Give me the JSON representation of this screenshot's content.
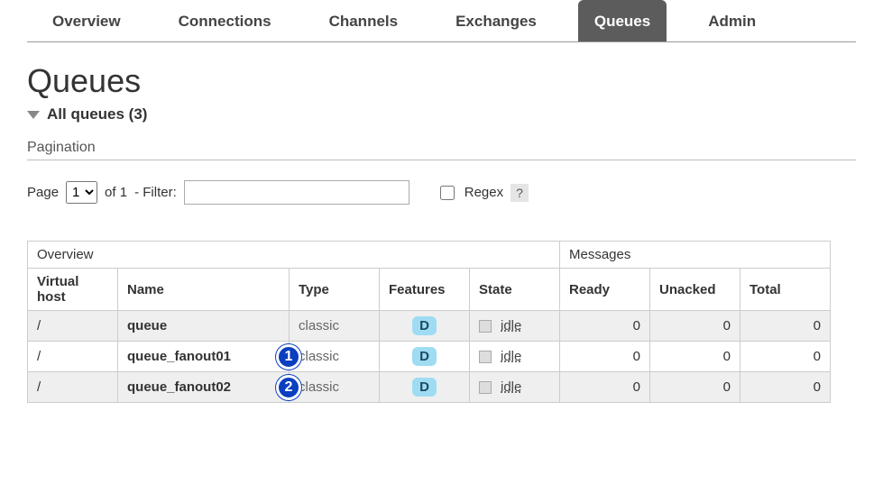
{
  "nav": {
    "overview": "Overview",
    "connections": "Connections",
    "channels": "Channels",
    "exchanges": "Exchanges",
    "queues": "Queues",
    "admin": "Admin"
  },
  "page_title": "Queues",
  "all_queues_label": "All queues (3)",
  "pagination_heading": "Pagination",
  "pag": {
    "page_label": "Page",
    "page_value": "1",
    "of_label": "of 1",
    "filter_label": "- Filter:",
    "filter_value": "",
    "regex_label": "Regex",
    "help": "?"
  },
  "tbl": {
    "group_overview": "Overview",
    "group_messages": "Messages",
    "col_vhost": "Virtual host",
    "col_name": "Name",
    "col_type": "Type",
    "col_features": "Features",
    "col_state": "State",
    "col_ready": "Ready",
    "col_unacked": "Unacked",
    "col_total": "Total"
  },
  "rows": [
    {
      "vhost": "/",
      "name": "queue",
      "type": "classic",
      "feature": "D",
      "state": "idle",
      "ready": "0",
      "unacked": "0",
      "total": "0",
      "annot": ""
    },
    {
      "vhost": "/",
      "name": "queue_fanout01",
      "type": "classic",
      "feature": "D",
      "state": "idle",
      "ready": "0",
      "unacked": "0",
      "total": "0",
      "annot": "1"
    },
    {
      "vhost": "/",
      "name": "queue_fanout02",
      "type": "classic",
      "feature": "D",
      "state": "idle",
      "ready": "0",
      "unacked": "0",
      "total": "0",
      "annot": "2"
    }
  ]
}
